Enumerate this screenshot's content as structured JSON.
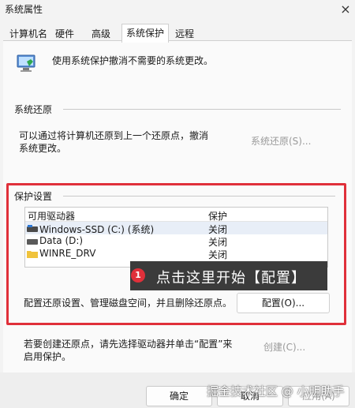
{
  "window": {
    "title": "系统属性",
    "close_glyph": "×"
  },
  "tabs": [
    "计算机名",
    "硬件",
    "高级",
    "系统保护",
    "远程"
  ],
  "active_tab_index": 3,
  "intro": {
    "text": "使用系统保护撤消不需要的系统更改。",
    "icon": "system-protection-icon"
  },
  "restore": {
    "section_title": "系统还原",
    "description_line1": "可以通过将计算机还原到上一个还原点，撤消",
    "description_line2": "系统更改。",
    "button_label": "系统还原(S)..."
  },
  "protection": {
    "section_title": "保护设置",
    "columns": [
      "可用驱动器",
      "保护"
    ],
    "drives": [
      {
        "name": "Windows-SSD (C:) (系统)",
        "status": "关闭",
        "icon": "system-drive-icon"
      },
      {
        "name": "Data (D:)",
        "status": "关闭",
        "icon": "drive-icon"
      },
      {
        "name": "WINRE_DRV",
        "status": "关闭",
        "icon": "folder-icon"
      }
    ],
    "config_text": "配置还原设置、管理磁盘空间，并且删除还原点。",
    "config_button": "配置(O)...",
    "create_text_line1": "若要创建还原点，请先选择驱动器并单击“配置”来",
    "create_text_line2": "启用保护。",
    "create_button": "创建(C)..."
  },
  "annotation": {
    "badge": "1",
    "text": "点击这里开始【配置】"
  },
  "footer": {
    "ok_label": "确定",
    "cancel_label": "取消",
    "apply_label": "应用(A)"
  },
  "watermark": "掘金技术社区 @ 小明助手",
  "colors": {
    "highlight_border": "#e0303a",
    "tooltip_bg": "#3b3b3b",
    "folder": "#f0c33c"
  }
}
